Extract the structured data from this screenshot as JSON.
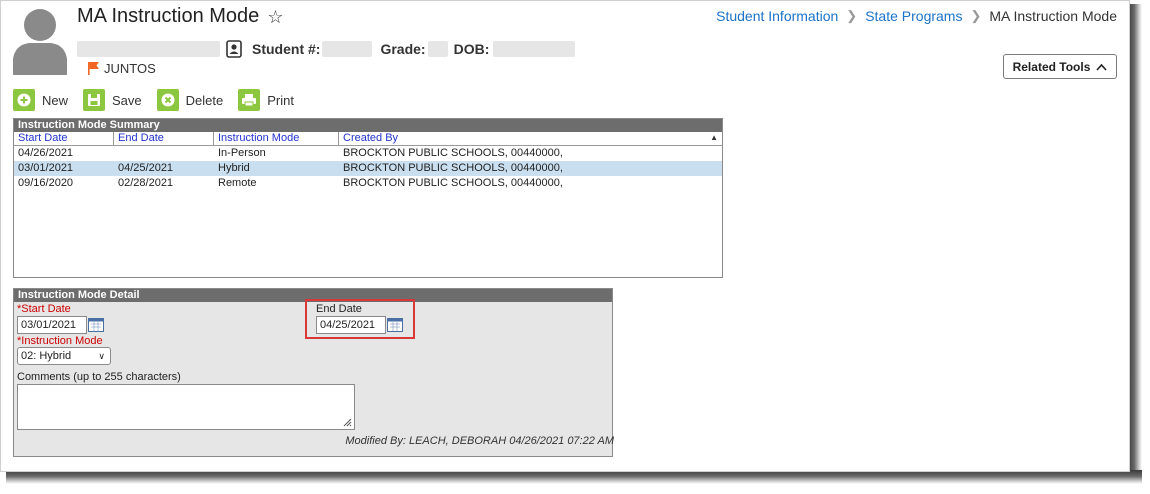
{
  "header": {
    "title": "MA Instruction Mode",
    "breadcrumb": [
      "Student Information",
      "State Programs",
      "MA Instruction Mode"
    ],
    "student_label": "Student #:",
    "grade_label": "Grade:",
    "dob_label": "DOB:",
    "program_flag": "JUNTOS",
    "related_tools_label": "Related Tools"
  },
  "toolbar": {
    "new_label": "New",
    "save_label": "Save",
    "delete_label": "Delete",
    "print_label": "Print"
  },
  "summary": {
    "title": "Instruction Mode Summary",
    "columns": [
      "Start Date",
      "End Date",
      "Instruction Mode",
      "Created By"
    ],
    "rows": [
      {
        "start": "04/26/2021",
        "end": "",
        "mode": "In-Person",
        "created_by": "BROCKTON PUBLIC SCHOOLS, 00440000,"
      },
      {
        "start": "03/01/2021",
        "end": "04/25/2021",
        "mode": "Hybrid",
        "created_by": "BROCKTON PUBLIC SCHOOLS, 00440000,",
        "selected": true
      },
      {
        "start": "09/16/2020",
        "end": "02/28/2021",
        "mode": "Remote",
        "created_by": "BROCKTON PUBLIC SCHOOLS, 00440000,"
      }
    ]
  },
  "detail": {
    "title": "Instruction Mode Detail",
    "start_date_label": "Start Date",
    "start_date_value": "03/01/2021",
    "end_date_label": "End Date",
    "end_date_value": "04/25/2021",
    "mode_label": "Instruction Mode",
    "mode_value": "02: Hybrid",
    "comments_label": "Comments (up to 255 characters)",
    "comments_value": "",
    "modified_by": "Modified By: LEACH, DEBORAH 04/26/2021 07:22 AM",
    "required_marker": "*"
  },
  "colors": {
    "accent_link": "#1a73c9",
    "toolbar_icon": "#8dc63f",
    "panel_header": "#6d6d6d",
    "selected_row": "#c9dff0",
    "highlight_box": "#d9373a",
    "flag": "#f26522"
  }
}
